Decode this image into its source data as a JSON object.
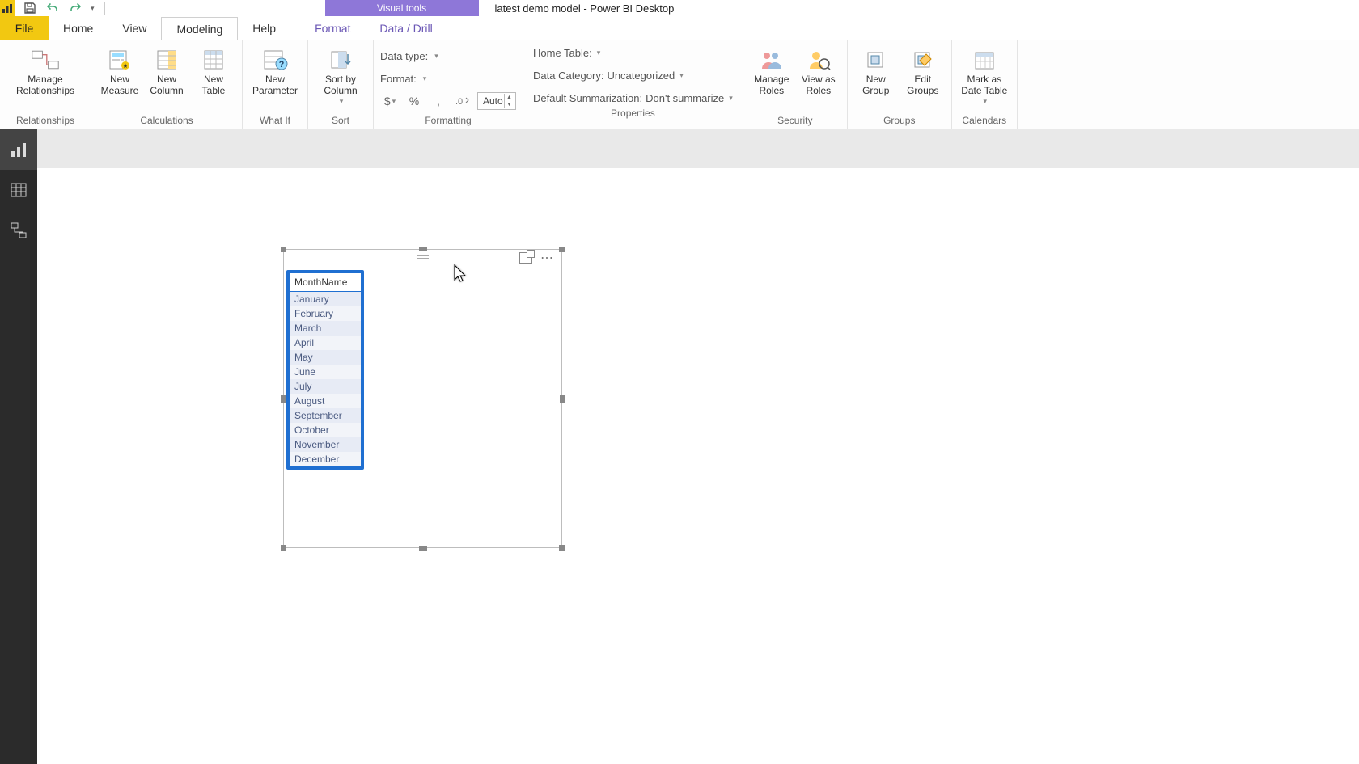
{
  "title": "latest demo model - Power BI Desktop",
  "contextual_tab": "Visual tools",
  "tabs": {
    "file": "File",
    "home": "Home",
    "view": "View",
    "modeling": "Modeling",
    "help": "Help",
    "format": "Format",
    "datadrill": "Data / Drill"
  },
  "ribbon": {
    "relationships": {
      "group": "Relationships",
      "manage": "Manage\nRelationships"
    },
    "calculations": {
      "group": "Calculations",
      "new_measure": "New\nMeasure",
      "new_column": "New\nColumn",
      "new_table": "New\nTable"
    },
    "whatif": {
      "group": "What If",
      "new_parameter": "New\nParameter"
    },
    "sort": {
      "group": "Sort",
      "sortby": "Sort by\nColumn"
    },
    "formatting": {
      "group": "Formatting",
      "datatype_label": "Data type:",
      "format_label": "Format:",
      "currency": "$",
      "percent": "%",
      "comma": ",",
      "decimals": ".0",
      "auto": "Auto"
    },
    "properties": {
      "group": "Properties",
      "home_table": "Home Table:",
      "data_category_label": "Data Category:",
      "data_category_value": "Uncategorized",
      "default_sum_label": "Default Summarization:",
      "default_sum_value": "Don't summarize"
    },
    "security": {
      "group": "Security",
      "manage_roles": "Manage\nRoles",
      "view_as_roles": "View as\nRoles"
    },
    "groups": {
      "group": "Groups",
      "new_group": "New\nGroup",
      "edit_groups": "Edit\nGroups"
    },
    "calendars": {
      "group": "Calendars",
      "mark_date": "Mark as\nDate Table"
    }
  },
  "visual": {
    "column_header": "MonthName",
    "rows": [
      "January",
      "February",
      "March",
      "April",
      "May",
      "June",
      "July",
      "August",
      "September",
      "October",
      "November",
      "December"
    ]
  }
}
